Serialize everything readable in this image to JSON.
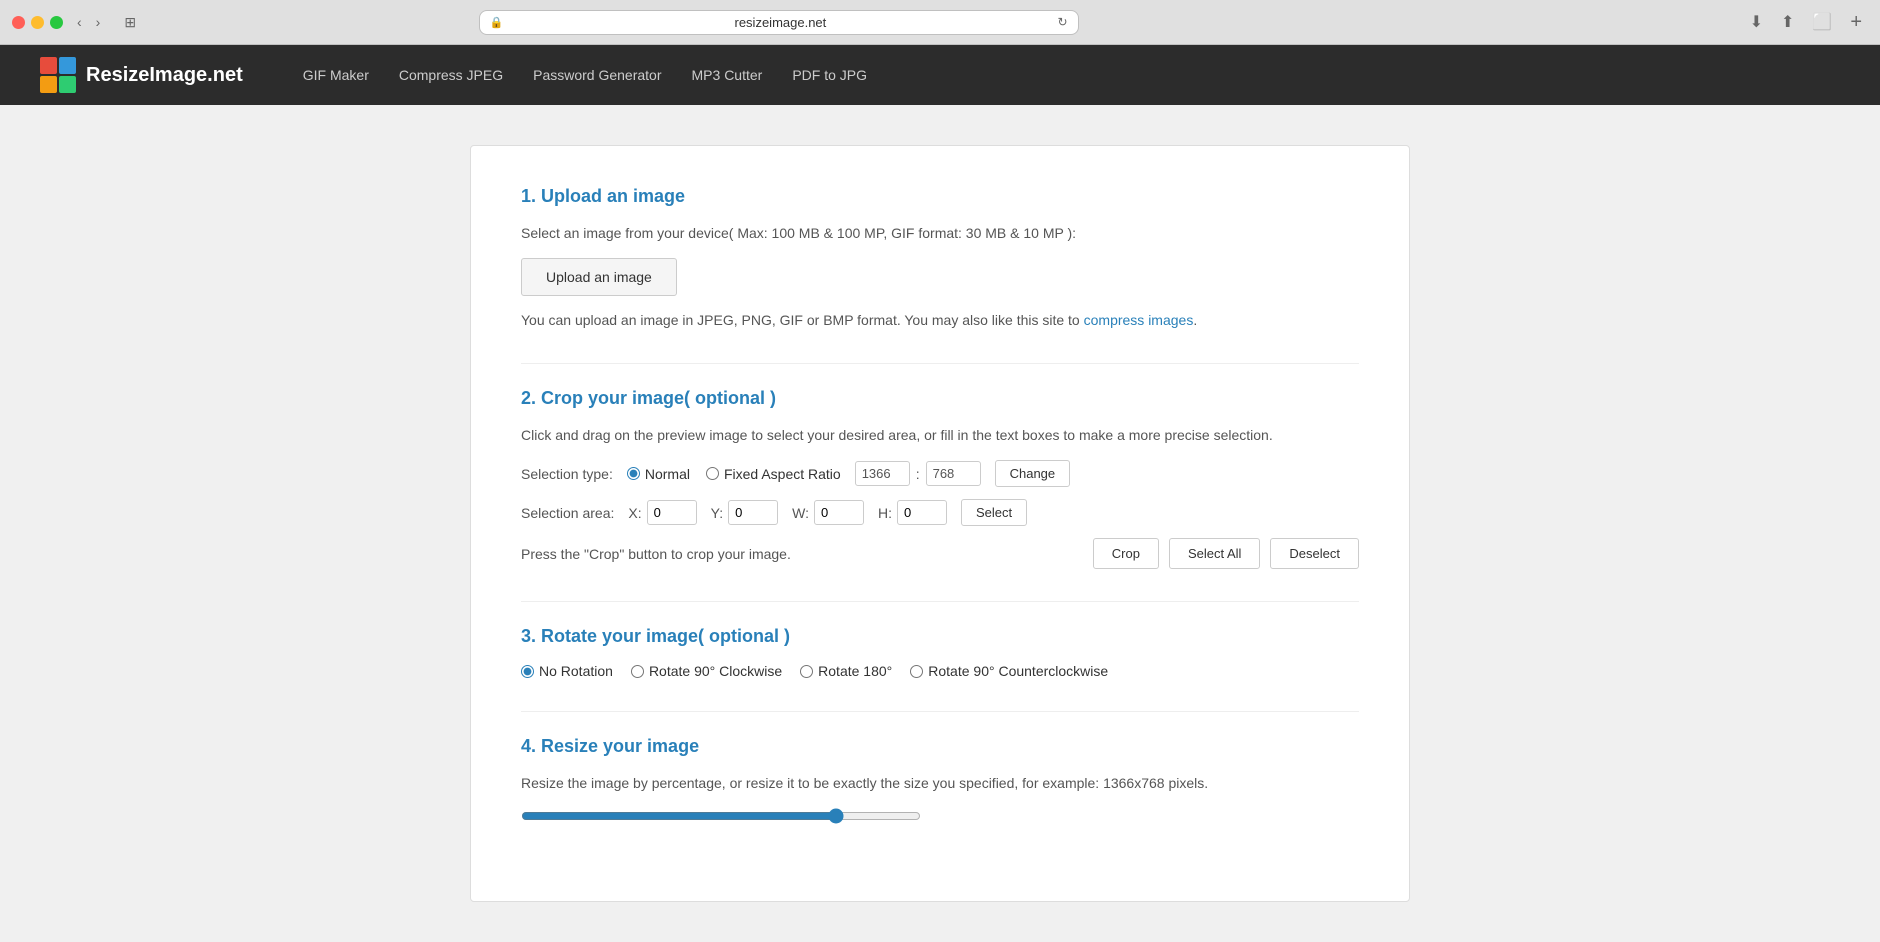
{
  "browser": {
    "address": "resizeimage.net",
    "reload_label": "↻",
    "back_label": "‹",
    "forward_label": "›",
    "tab_label": "⊞",
    "new_tab_label": "+"
  },
  "site": {
    "logo_text": "ResizeImage.net",
    "nav": [
      {
        "label": "GIF Maker",
        "id": "gif-maker"
      },
      {
        "label": "Compress JPEG",
        "id": "compress-jpeg"
      },
      {
        "label": "Password Generator",
        "id": "password-generator"
      },
      {
        "label": "MP3 Cutter",
        "id": "mp3-cutter"
      },
      {
        "label": "PDF to JPG",
        "id": "pdf-to-jpg"
      }
    ]
  },
  "sections": {
    "upload": {
      "title": "1. Upload an image",
      "description": "Select an image from your device( Max: 100 MB & 100 MP, GIF format: 30 MB & 10 MP ):",
      "button_label": "Upload an image",
      "note": "You can upload an image in JPEG, PNG, GIF or BMP format. You may also like this site to ",
      "link_text": "compress images",
      "note_end": "."
    },
    "crop": {
      "title": "2. Crop your image( optional )",
      "description": "Click and drag on the preview image to select your desired area, or fill in the text boxes to make a more precise selection.",
      "selection_type_label": "Selection type:",
      "normal_label": "Normal",
      "fixed_aspect_label": "Fixed Aspect Ratio",
      "aspect_w": "1366",
      "aspect_sep": ":",
      "aspect_h": "768",
      "change_btn": "Change",
      "selection_area_label": "Selection area:",
      "x_label": "X:",
      "x_val": "0",
      "y_label": "Y:",
      "y_val": "0",
      "w_label": "W:",
      "w_val": "0",
      "h_label": "H:",
      "h_val": "0",
      "select_btn": "Select",
      "crop_hint": "Press the \"Crop\" button to crop your image.",
      "crop_btn": "Crop",
      "select_all_btn": "Select All",
      "deselect_btn": "Deselect"
    },
    "rotate": {
      "title": "3. Rotate your image( optional )",
      "options": [
        {
          "label": "No Rotation",
          "value": "none",
          "checked": true
        },
        {
          "label": "Rotate 90° Clockwise",
          "value": "cw90",
          "checked": false
        },
        {
          "label": "Rotate 180°",
          "value": "180",
          "checked": false
        },
        {
          "label": "Rotate 90° Counterclockwise",
          "value": "ccw90",
          "checked": false
        }
      ]
    },
    "resize": {
      "title": "4. Resize your image",
      "description": "Resize the image by percentage, or resize it to be exactly the size you specified, for example: 1366x768 pixels.",
      "slider_value": "80"
    }
  }
}
